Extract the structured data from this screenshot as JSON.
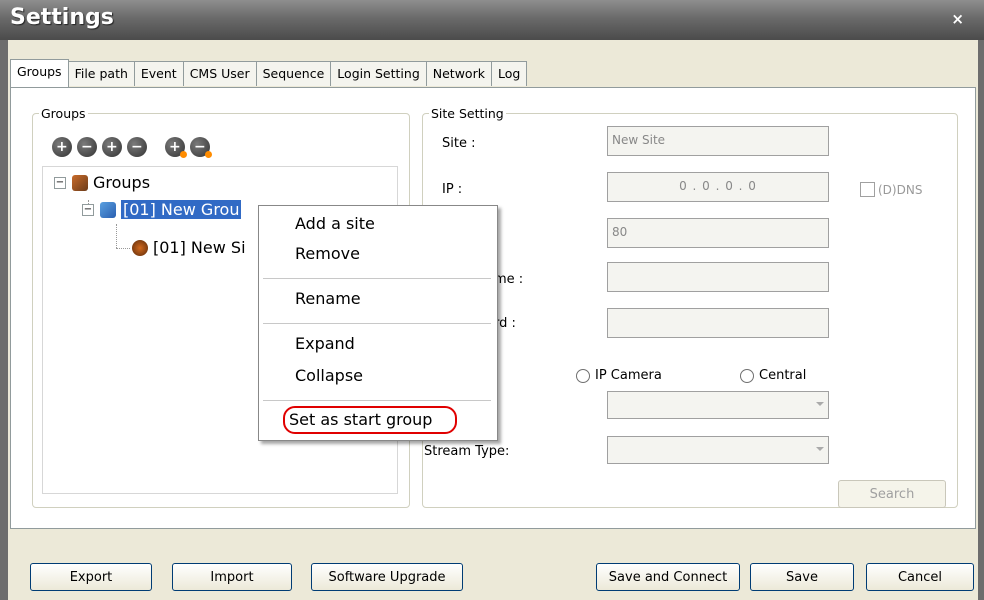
{
  "window": {
    "title": "Settings",
    "close_glyph": "×"
  },
  "tabs": [
    "Groups",
    "File path",
    "Event",
    "CMS User",
    "Sequence",
    "Login Setting",
    "Network",
    "Log"
  ],
  "groups_panel": {
    "title": "Groups",
    "toolbar_icons": [
      "add-group-icon",
      "remove-group-icon",
      "add-site-icon",
      "remove-site-icon",
      "move-up-icon",
      "move-down-icon"
    ],
    "tree": {
      "root": "Groups",
      "group": "[01] New Grou",
      "site": "[01] New Si"
    }
  },
  "context_menu": {
    "items": [
      "Add a site",
      "Remove",
      "Rename",
      "Expand",
      "Collapse",
      "Set as start group"
    ],
    "highlighted_item": "Set as start group",
    "highlight_color": "#e00000"
  },
  "site_setting": {
    "title": "Site Setting",
    "site_label": "Site :",
    "site_value": "New Site",
    "ip_label": "IP :",
    "ip_value": "0 . 0 . 0 . 0",
    "dns_label": "(D)DNS",
    "port_value": "80",
    "username_label_fragment": "me :",
    "password_label_fragment": "rd :",
    "radio_ip_camera": "IP Camera",
    "radio_central": "Central",
    "stream_type_label": "Stream Type:",
    "search_button": "Search"
  },
  "footer": {
    "export": "Export",
    "import": "Import",
    "software_upgrade": "Software Upgrade",
    "save_connect": "Save and Connect",
    "save": "Save",
    "cancel": "Cancel"
  },
  "colors": {
    "selection": "#316ac5",
    "highlight_oval": "#e00000",
    "title_bar": "#5a5a5a"
  }
}
